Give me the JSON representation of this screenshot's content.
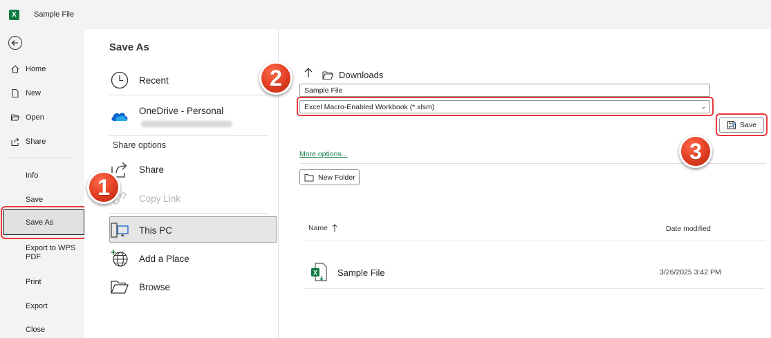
{
  "window": {
    "title": "Sample File",
    "app_icon": "excel-icon"
  },
  "nav": {
    "top_items": [
      {
        "label": "Home",
        "icon": "home-icon"
      },
      {
        "label": "New",
        "icon": "new-file-icon"
      },
      {
        "label": "Open",
        "icon": "open-folder-icon"
      },
      {
        "label": "Share",
        "icon": "share-icon"
      }
    ],
    "bottom_items": [
      "Info",
      "Save",
      "Save As",
      "Export to WPS PDF",
      "Print",
      "Export",
      "Close"
    ],
    "active": "Save As"
  },
  "save_as": {
    "title": "Save As",
    "locations": {
      "recent": "Recent",
      "onedrive": "OneDrive - Personal",
      "share_options_header": "Share options",
      "share": "Share",
      "copy_link": "Copy Link",
      "this_pc": "This PC",
      "add_place": "Add a Place",
      "browse": "Browse"
    }
  },
  "file_panel": {
    "current_folder": "Downloads",
    "filename_value": "Sample File",
    "filetype_value": "Excel Macro-Enabled Workbook (*.xlsm)",
    "save_label": "Save",
    "more_options": "More options...",
    "new_folder": "New Folder",
    "columns": {
      "name": "Name",
      "date": "Date modified"
    },
    "files": [
      {
        "name": "Sample File",
        "date": "3/26/2025 3:42 PM"
      }
    ]
  },
  "annotations": {
    "steps": [
      "1",
      "2",
      "3"
    ],
    "highlight_color": "#e8383d",
    "badge_color": "#e03e22"
  },
  "colors": {
    "accent": "#107c41",
    "nav_bg": "#f3f3f3"
  }
}
